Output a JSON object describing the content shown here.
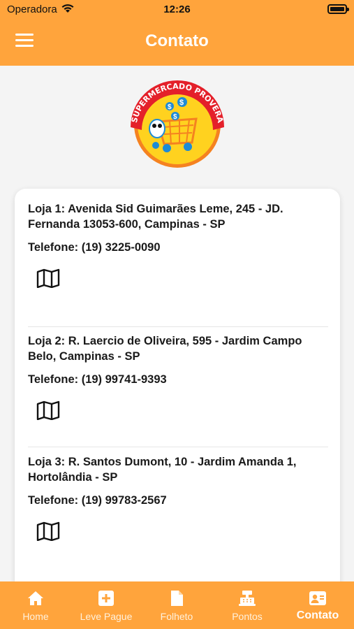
{
  "status_bar": {
    "carrier": "Operadora",
    "time": "12:26"
  },
  "header": {
    "title": "Contato"
  },
  "logo": {
    "brand_text": "SUPERMERCADO PROVERÁ",
    "colors": {
      "ring": "#e4202a",
      "sun": "#ffd21f",
      "accent": "#1e8bd6"
    }
  },
  "stores": [
    {
      "address": "Loja 1: Avenida Sid Guimarães Leme, 245 - JD. Fernanda 13053-600, Campinas - SP",
      "phone": "Telefone: (19) 3225-0090",
      "icon": "map-icon"
    },
    {
      "address": "Loja 2:  R. Laercio de Oliveira, 595 - Jardim Campo Belo, Campinas - SP",
      "phone": "Telefone: (19) 99741-9393",
      "icon": "map-icon"
    },
    {
      "address": "Loja 3:  R. Santos Dumont, 10 - Jardim Amanda 1, Hortolândia - SP",
      "phone": "Telefone: (19) 99783-2567",
      "icon": "map-icon"
    }
  ],
  "tabs": [
    {
      "label": "Home",
      "icon": "home-icon",
      "active": false
    },
    {
      "label": "Leve Pague",
      "icon": "plus-box-icon",
      "active": false
    },
    {
      "label": "Folheto",
      "icon": "document-icon",
      "active": false
    },
    {
      "label": "Pontos",
      "icon": "cash-register-icon",
      "active": false
    },
    {
      "label": "Contato",
      "icon": "contact-card-icon",
      "active": true
    }
  ],
  "colors": {
    "brand": "#ffa43c",
    "background": "#f4f4f4",
    "card": "#ffffff",
    "text": "#1a1a1a"
  }
}
